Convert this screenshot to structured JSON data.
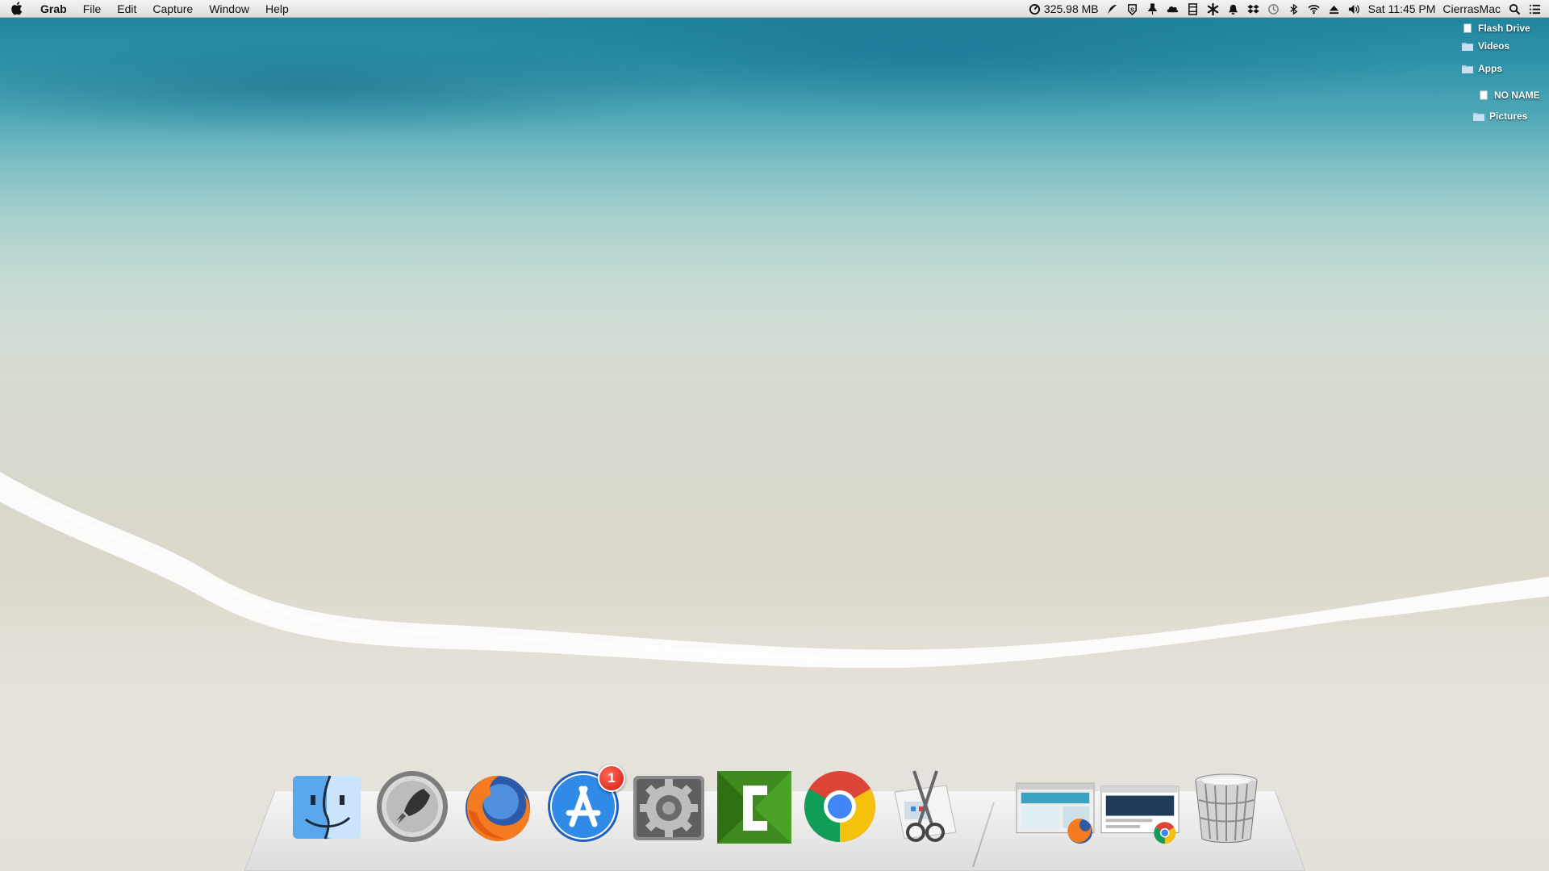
{
  "menubar": {
    "app_name": "Grab",
    "menus": [
      "File",
      "Edit",
      "Capture",
      "Window",
      "Help"
    ],
    "memory": "325.98 MB",
    "clock": "Sat 11:45 PM",
    "user": "CierrasMac",
    "status_icons": [
      "memory-gauge-icon",
      "feather-icon",
      "s-badge-icon",
      "pin-icon",
      "cloud-icon",
      "film-icon",
      "asterisk-icon",
      "bell-icon",
      "dropbox-icon",
      "time-machine-icon",
      "bluetooth-icon",
      "wifi-icon",
      "eject-icon",
      "volume-icon",
      "spotlight-icon",
      "notification-center-icon"
    ]
  },
  "desktop_icons": [
    {
      "label": "Flash Drive",
      "type": "drive"
    },
    {
      "label": "Videos",
      "type": "folder"
    },
    {
      "label": "Apps",
      "type": "folder"
    },
    {
      "label": "NO NAME",
      "type": "drive"
    },
    {
      "label": "Pictures",
      "type": "folder"
    }
  ],
  "dock": {
    "apps": [
      {
        "name": "Finder",
        "icon": "finder-icon"
      },
      {
        "name": "Launchpad",
        "icon": "launchpad-icon"
      },
      {
        "name": "Firefox",
        "icon": "firefox-icon"
      },
      {
        "name": "App Store",
        "icon": "app-store-icon",
        "badge": "1"
      },
      {
        "name": "System Preferences",
        "icon": "system-preferences-icon"
      },
      {
        "name": "Camtasia",
        "icon": "camtasia-icon"
      },
      {
        "name": "Google Chrome",
        "icon": "chrome-icon"
      },
      {
        "name": "Grab",
        "icon": "grab-scissors-icon"
      }
    ],
    "minimized": [
      {
        "name": "Firefox window",
        "icon": "firefox-window-thumbnail"
      },
      {
        "name": "Chrome window",
        "icon": "chrome-window-thumbnail"
      }
    ],
    "trash": {
      "name": "Trash",
      "icon": "trash-icon"
    }
  },
  "colors": {
    "water": "#2e93aa",
    "sand": "#e4e1da",
    "menubar": "#e9e9e9",
    "badge": "#d5170a"
  }
}
